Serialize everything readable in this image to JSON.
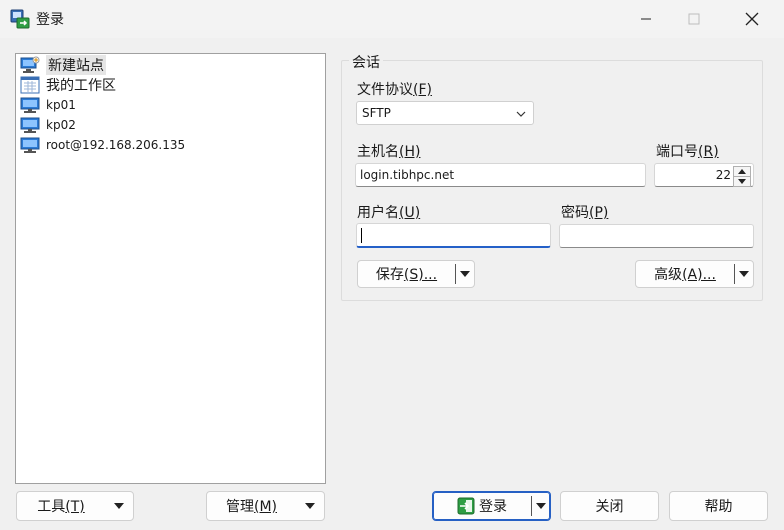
{
  "window": {
    "title": "登录"
  },
  "tree": {
    "items": [
      {
        "label": "新建站点",
        "icon": "new-site-icon"
      },
      {
        "label": "我的工作区",
        "icon": "workspace-icon"
      },
      {
        "label": "kp01",
        "icon": "computer-icon"
      },
      {
        "label": "kp02",
        "icon": "computer-icon"
      },
      {
        "label": "root@192.168.206.135",
        "icon": "computer-icon"
      }
    ]
  },
  "session": {
    "group_title": "会话",
    "protocol_label": "文件协议",
    "protocol_accel": "(F)",
    "protocol_value": "SFTP",
    "host_label": "主机名",
    "host_accel": "(H)",
    "host_value": "login.tibhpc.net",
    "port_label": "端口号",
    "port_accel": "(R)",
    "port_value": "22",
    "user_label": "用户名",
    "user_accel": "(U)",
    "user_value": "",
    "password_label": "密码",
    "password_accel": "(P)",
    "password_value": "",
    "save_label": "保存",
    "save_accel": "(S)...",
    "advanced_label": "高级",
    "advanced_accel": "(A)..."
  },
  "footer": {
    "tools_label": "工具",
    "tools_accel": "(T)",
    "manage_label": "管理",
    "manage_accel": "(M)",
    "login_label": "登录",
    "close_label": "关闭",
    "help_label": "帮助"
  }
}
